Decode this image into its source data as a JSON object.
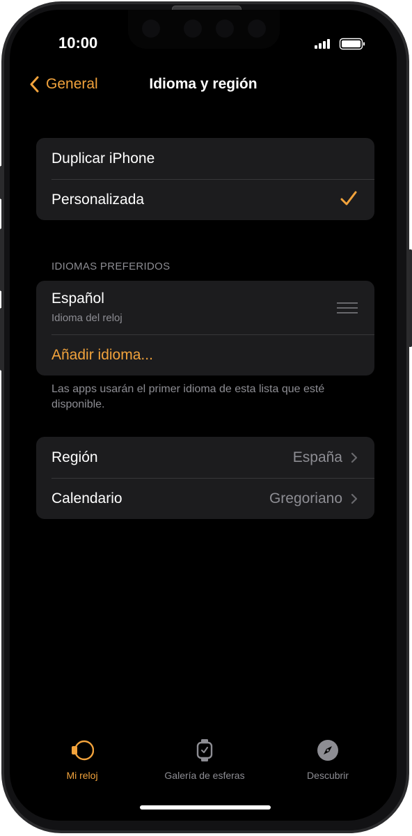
{
  "status_bar": {
    "time": "10:00"
  },
  "nav": {
    "back_label": "General",
    "title": "Idioma y región"
  },
  "mode_group": {
    "items": [
      {
        "label": "Duplicar iPhone"
      },
      {
        "label": "Personalizada",
        "checked": true
      }
    ]
  },
  "languages": {
    "header": "IDIOMAS PREFERIDOS",
    "items": [
      {
        "name": "Español",
        "subtitle": "Idioma del reloj"
      }
    ],
    "add_label": "Añadir idioma...",
    "footnote": "Las apps usarán el primer idioma de esta lista que esté disponible."
  },
  "region_group": {
    "items": [
      {
        "label": "Región",
        "value": "España"
      },
      {
        "label": "Calendario",
        "value": "Gregoriano"
      }
    ]
  },
  "tab_bar": {
    "tabs": [
      {
        "label": "Mi reloj",
        "icon": "watch-icon",
        "active": true
      },
      {
        "label": "Galería de esferas",
        "icon": "watch-face-icon",
        "active": false
      },
      {
        "label": "Descubrir",
        "icon": "compass-icon",
        "active": false
      }
    ]
  },
  "colors": {
    "accent": "#f2a33c",
    "background": "#000000",
    "cell": "#1c1c1e",
    "secondary_text": "#8d8d93"
  }
}
